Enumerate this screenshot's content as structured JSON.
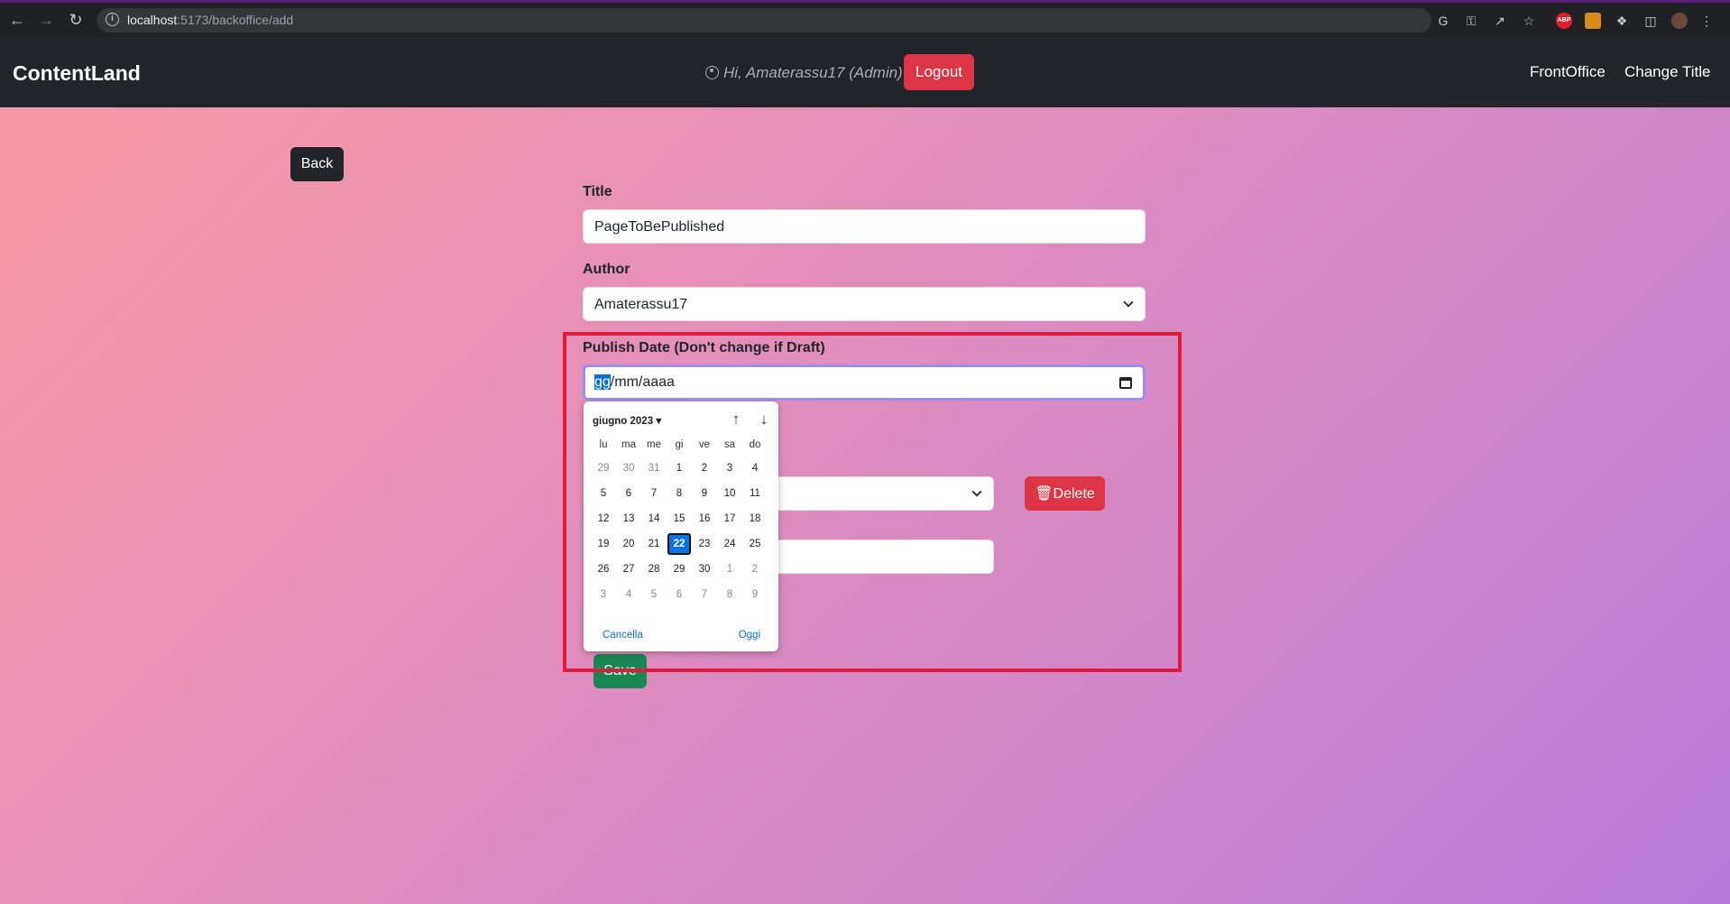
{
  "browser": {
    "url_host": "localhost",
    "url_rest": ":5173/backoffice/add"
  },
  "navbar": {
    "brand": "ContentLand",
    "greeting": "Hi, Amaterassu17 (Admin)",
    "logout_label": "Logout",
    "links": [
      "FrontOffice",
      "Change Title"
    ]
  },
  "page": {
    "back_label": "Back",
    "title_label": "Title",
    "title_value": "PageToBePublished",
    "author_label": "Author",
    "author_value": "Amaterassu17",
    "publish_label": "Publish Date (Don't change if Draft)",
    "date_selected_part": "gg",
    "date_rest": "/mm/aaaa",
    "delete_label": "Delete",
    "save_label": "Save"
  },
  "calendar": {
    "month_label": "giugno 2023",
    "weekdays": [
      "lu",
      "ma",
      "me",
      "gi",
      "ve",
      "sa",
      "do"
    ],
    "weeks": [
      [
        "29",
        "30",
        "31",
        "1",
        "2",
        "3",
        "4"
      ],
      [
        "5",
        "6",
        "7",
        "8",
        "9",
        "10",
        "11"
      ],
      [
        "12",
        "13",
        "14",
        "15",
        "16",
        "17",
        "18"
      ],
      [
        "19",
        "20",
        "21",
        "22",
        "23",
        "24",
        "25"
      ],
      [
        "26",
        "27",
        "28",
        "29",
        "30",
        "1",
        "2"
      ],
      [
        "3",
        "4",
        "5",
        "6",
        "7",
        "8",
        "9"
      ]
    ],
    "today": "22",
    "clear_label": "Cancella",
    "today_label": "Oggi"
  },
  "colors": {
    "navbar_bg": "#212529",
    "danger": "#dc3545",
    "success": "#198754",
    "highlight_box": "#e2193a",
    "selected_day": "#0b74e5"
  }
}
